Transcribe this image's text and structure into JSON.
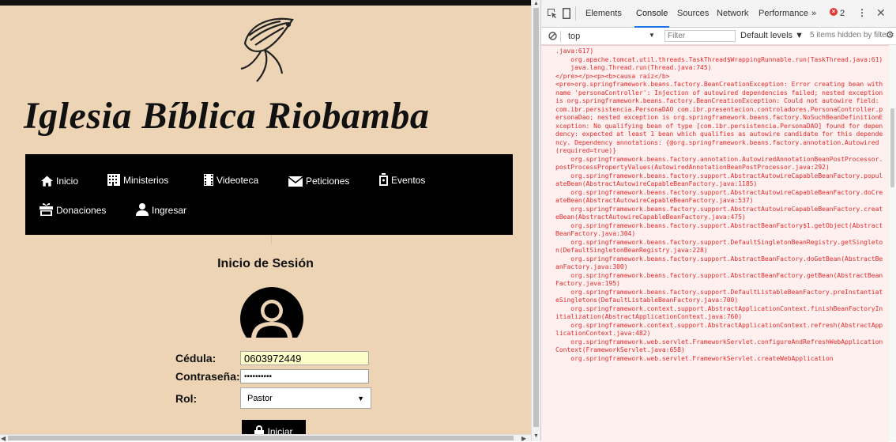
{
  "site": {
    "title": "Iglesia Bíblica Riobamba",
    "nav": [
      {
        "label": "Inicio",
        "icon": "home-icon"
      },
      {
        "label": "Ministerios",
        "icon": "building-icon"
      },
      {
        "label": "Videoteca",
        "icon": "film-icon"
      },
      {
        "label": "Peticiones",
        "icon": "envelope-icon"
      },
      {
        "label": "Eventos",
        "icon": "stopwatch-icon"
      },
      {
        "label": "Donaciones",
        "icon": "gift-icon"
      },
      {
        "label": "Ingresar",
        "icon": "user-icon"
      }
    ],
    "login": {
      "title": "Inicio de Sesión",
      "cedula_label": "Cédula:",
      "cedula_value": "0603972449",
      "password_label": "Contraseña:",
      "password_value": "••••••••••",
      "rol_label": "Rol:",
      "rol_value": "Pastor",
      "submit_label": "Iniciar"
    }
  },
  "devtools": {
    "tabs": [
      "Elements",
      "Console",
      "Sources",
      "Network",
      "Performance"
    ],
    "active_tab": "Console",
    "more_tabs": "»",
    "error_count": "2",
    "context": "top",
    "filter_placeholder": "Filter",
    "levels": "Default levels ▼",
    "hidden_info": "5 items hidden by filters",
    "console_text": ".java:617)\n    org.apache.tomcat.util.threads.TaskThread$WrappingRunnable.run(TaskThread.java:61)\n    java.lang.Thread.run(Thread.java:745)\n</pre></p><p><b>causa raíz</b>\n<pre>org.springframework.beans.factory.BeanCreationException: Error creating bean with name 'personaController': Injection of autowired dependencies failed; nested exception is org.springframework.beans.factory.BeanCreationException: Could not autowire field: com.ibr.persistencia.PersonaDAO com.ibr.presentacion.controladores.PersonaController.personaDao; nested exception is org.springframework.beans.factory.NoSuchBeanDefinitionException: No qualifying bean of type [com.ibr.persistencia.PersonaDAO] found for dependency: expected at least 1 bean which qualifies as autowire candidate for this dependency. Dependency annotations: {@org.springframework.beans.factory.annotation.Autowired(required=true)}\n    org.springframework.beans.factory.annotation.AutowiredAnnotationBeanPostProcessor.postProcessPropertyValues(AutowiredAnnotationBeanPostProcessor.java:292)\n    org.springframework.beans.factory.support.AbstractAutowireCapableBeanFactory.populateBean(AbstractAutowireCapableBeanFactory.java:1185)\n    org.springframework.beans.factory.support.AbstractAutowireCapableBeanFactory.doCreateBean(AbstractAutowireCapableBeanFactory.java:537)\n    org.springframework.beans.factory.support.AbstractAutowireCapableBeanFactory.createBean(AbstractAutowireCapableBeanFactory.java:475)\n    org.springframework.beans.factory.support.AbstractBeanFactory$1.getObject(AbstractBeanFactory.java:304)\n    org.springframework.beans.factory.support.DefaultSingletonBeanRegistry.getSingleton(DefaultSingletonBeanRegistry.java:228)\n    org.springframework.beans.factory.support.AbstractBeanFactory.doGetBean(AbstractBeanFactory.java:300)\n    org.springframework.beans.factory.support.AbstractBeanFactory.getBean(AbstractBeanFactory.java:195)\n    org.springframework.beans.factory.support.DefaultListableBeanFactory.preInstantiateSingletons(DefaultListableBeanFactory.java:700)\n    org.springframework.context.support.AbstractApplicationContext.finishBeanFactoryInitialization(AbstractApplicationContext.java:760)\n    org.springframework.context.support.AbstractApplicationContext.refresh(AbstractApplicationContext.java:482)\n    org.springframework.web.servlet.FrameworkServlet.configureAndRefreshWebApplicationContext(FrameworkServlet.java:658)\n    org.springframework.web.servlet.FrameworkServlet.createWebApplication"
  },
  "colors": {
    "page_bg": "#ecd4b4",
    "nav_bg": "#000000",
    "error_text": "#e42a2a",
    "error_bg": "#fff0f0",
    "devtools_accent": "#1a73e8"
  }
}
